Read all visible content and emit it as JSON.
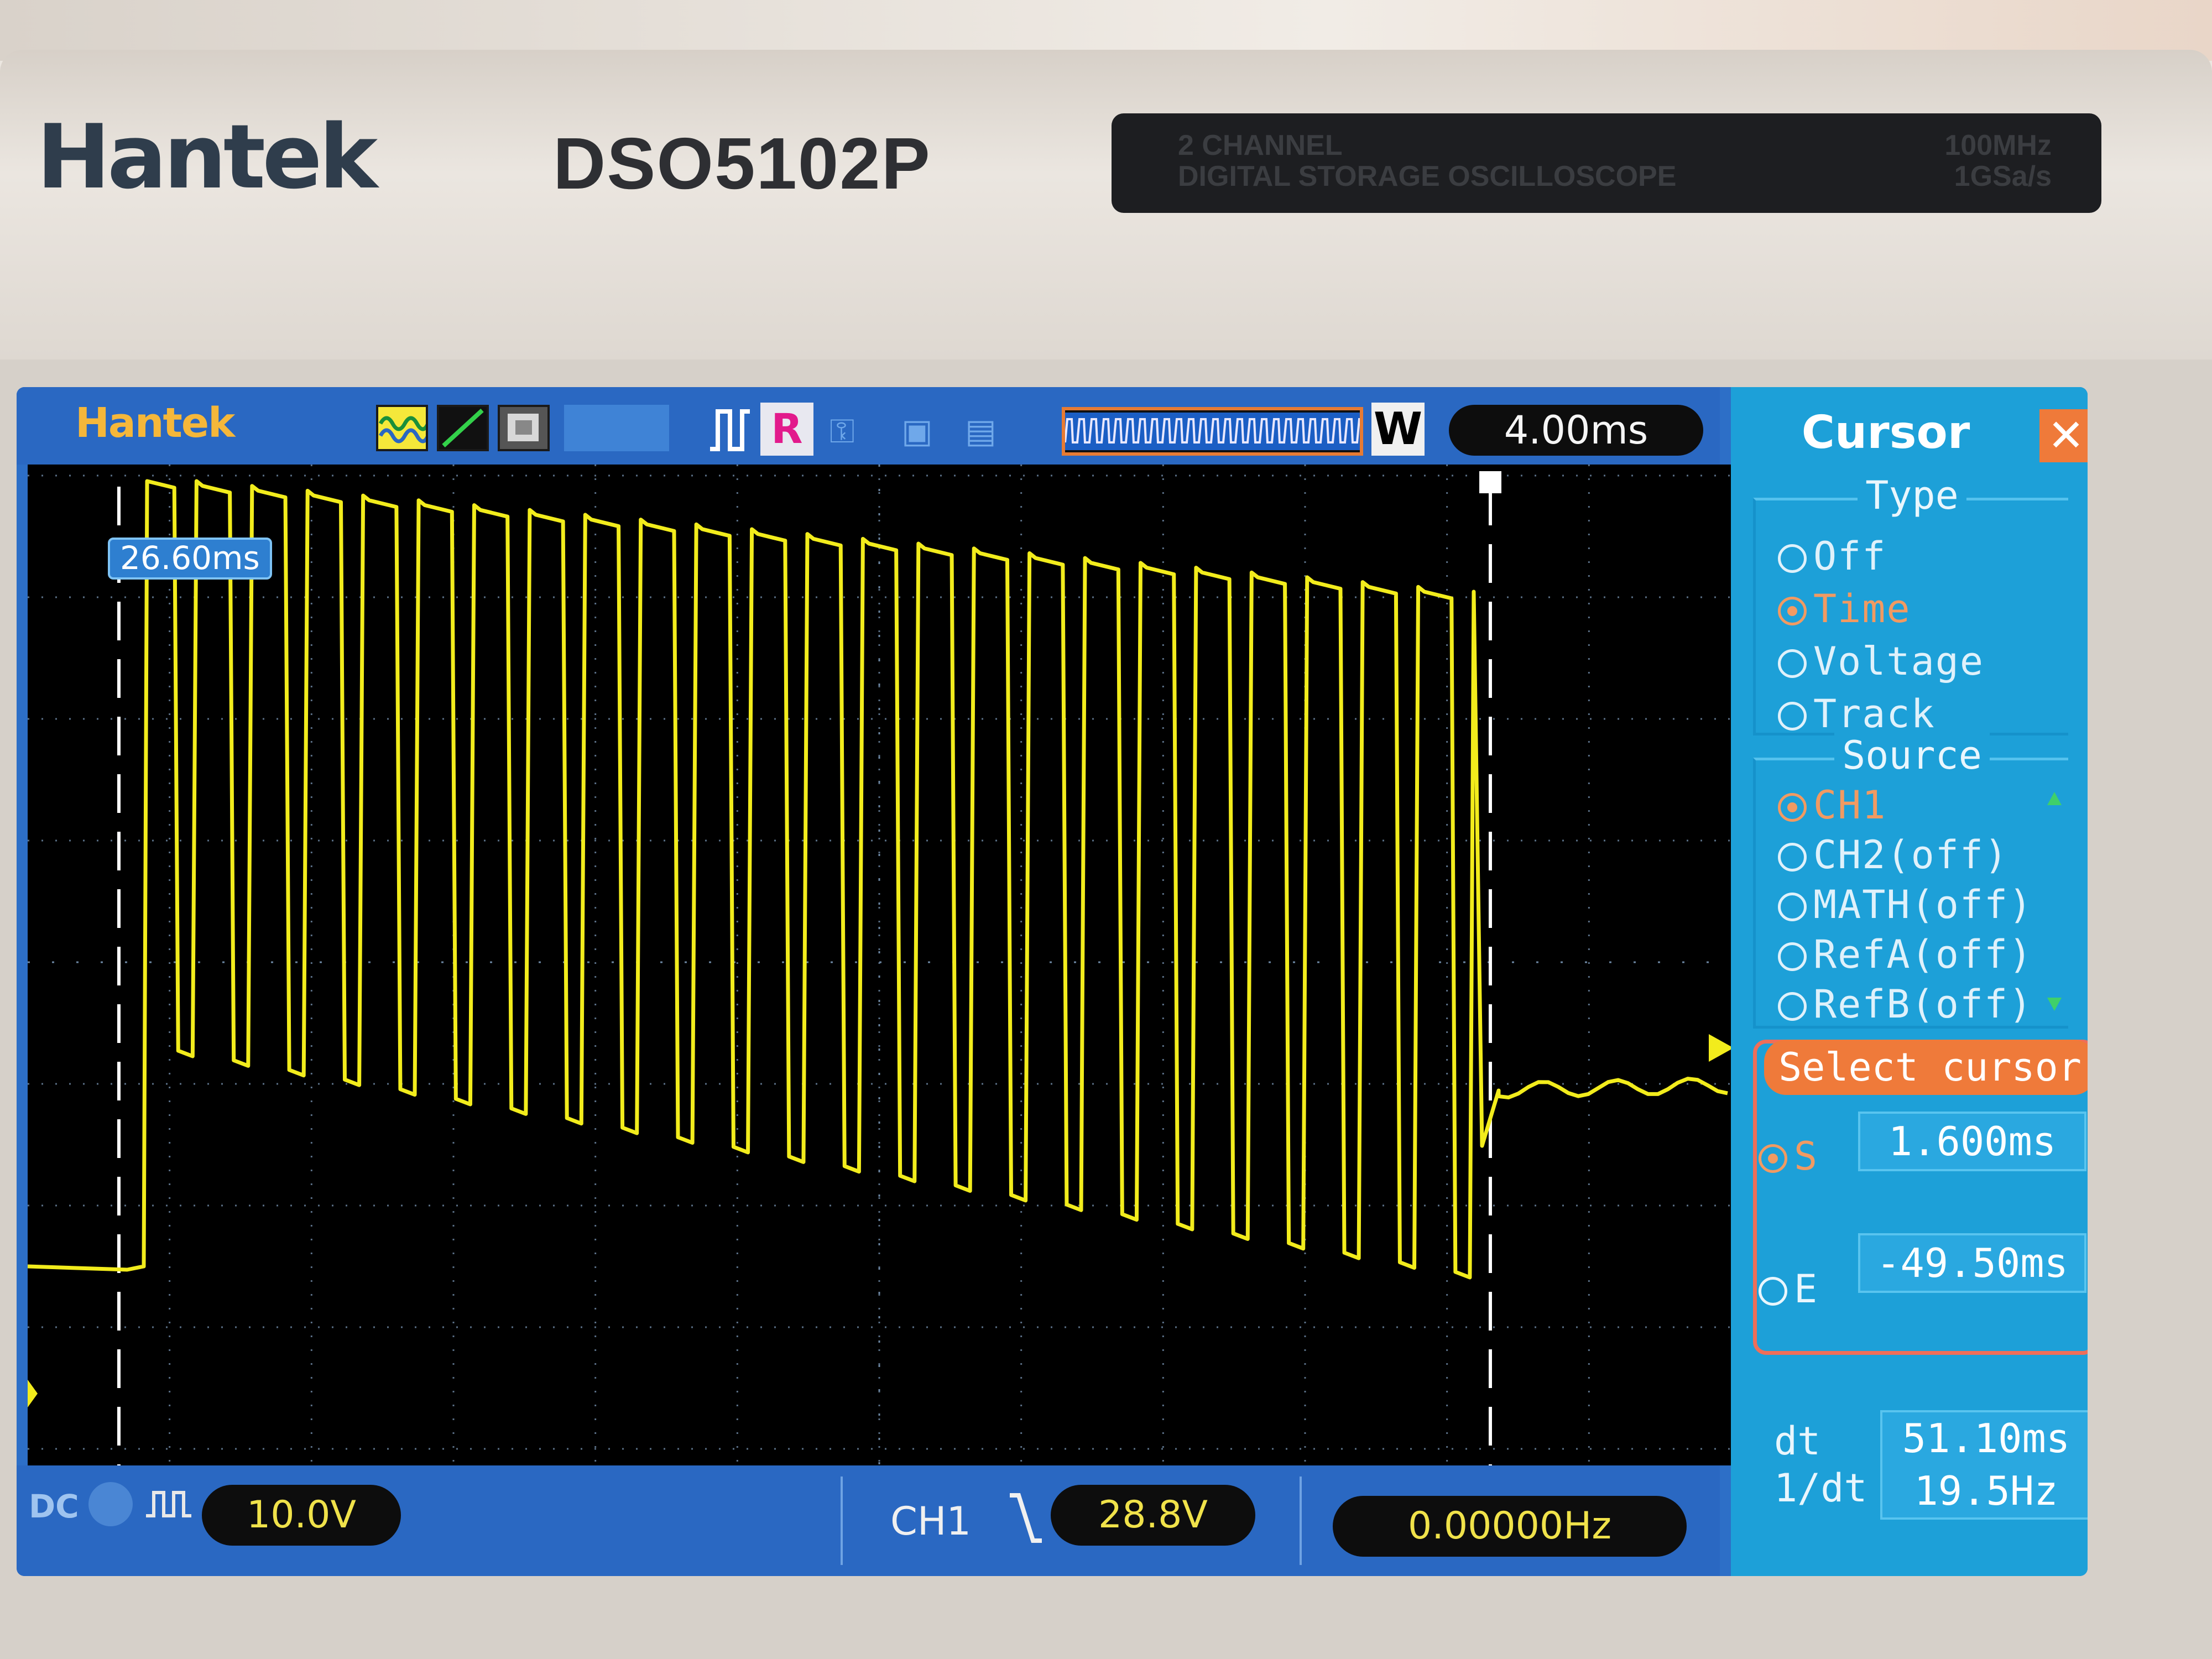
{
  "device": {
    "brand": "Hantek",
    "model": "DSO5102P",
    "plate_line1": "2 CHANNEL",
    "plate_line2": "DIGITAL STORAGE OSCILLOSCOPE",
    "plate_spec1": "100MHz",
    "plate_spec2": "1GSa/s"
  },
  "screen": {
    "brand": "Hantek",
    "trigger_letter": "R",
    "window_letter": "W",
    "timebase": "4.00ms",
    "trigger_position": "26.60ms",
    "colors": {
      "trace": "#f2ec1c",
      "background": "#000000",
      "panel": "#2a68c2",
      "menu": "#1da0d8",
      "accent": "#ef7a3a"
    }
  },
  "waveform": {
    "channel": "CH1",
    "pulse_count": 24,
    "after_level_divisions": 1.9
  },
  "bottom": {
    "coupling": "DC",
    "ch1_scale": "10.0V",
    "trigger_source": "CH1",
    "trigger_level": "28.8V",
    "frequency": "0.00000Hz"
  },
  "menu": {
    "title": "Cursor",
    "close_icon": "close-icon",
    "type_title": "Type",
    "type_options": [
      "Off",
      "Time",
      "Voltage",
      "Track"
    ],
    "type_selected": "Time",
    "source_title": "Source",
    "source_options": [
      "CH1",
      "CH2(off)",
      "MATH(off)",
      "RefA(off)",
      "RefB(off)"
    ],
    "source_selected": "CH1",
    "select_cursor_label": "Select cursor",
    "s_label": "S",
    "s_value": "1.600ms",
    "e_label": "E",
    "e_value": "-49.50ms",
    "selected_cursor": "S",
    "dt_label": "dt",
    "dt_value": "51.10ms",
    "inv_dt_label": "1/dt",
    "inv_dt_value": "19.5Hz"
  }
}
